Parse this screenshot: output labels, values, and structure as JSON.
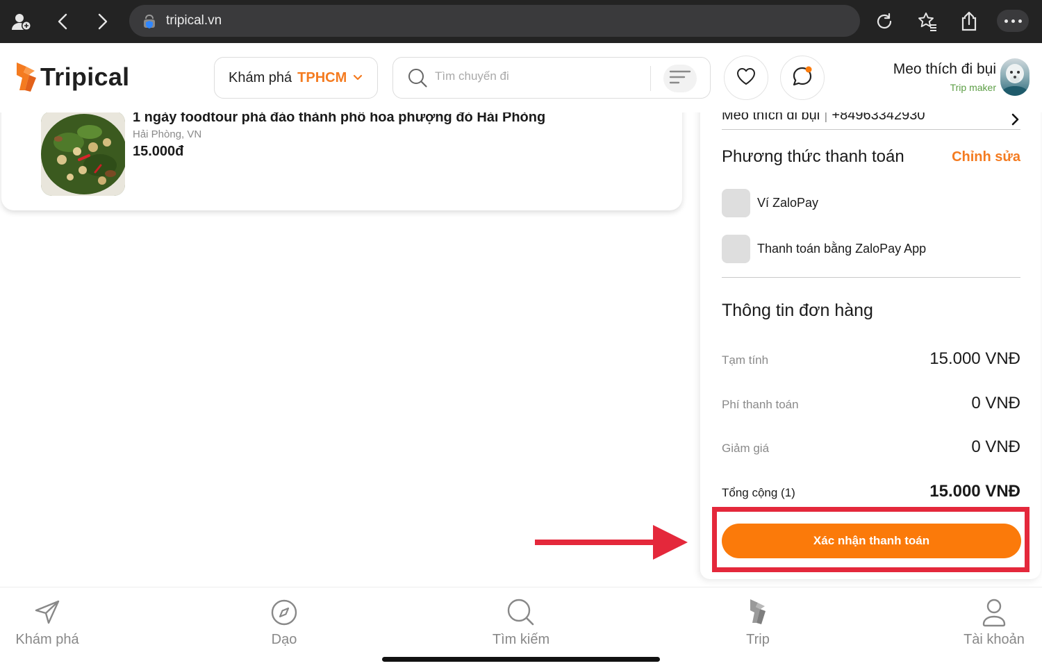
{
  "browser": {
    "url": "tripical.vn"
  },
  "header": {
    "logo_text": "Tripical",
    "explore_label": "Khám phá",
    "explore_city": "TPHCM",
    "search_placeholder": "Tìm chuyến đi",
    "user_name": "Meo thích đi bụi",
    "user_role": "Trip maker"
  },
  "product": {
    "title": "1 ngày foodtour phá đảo thành phố hoa phượng đỏ Hải Phòng",
    "location": "Hải Phòng, VN",
    "price": "15.000đ"
  },
  "checkout": {
    "contact_name": "Meo thích đi bụi",
    "contact_phone": "+84963342930",
    "payment_title": "Phương thức thanh toán",
    "payment_edit": "Chỉnh sửa",
    "payment_options": [
      {
        "label": "Ví ZaloPay"
      },
      {
        "label": "Thanh toán bằng ZaloPay App"
      }
    ],
    "order_title": "Thông tin đơn hàng",
    "order_rows": [
      {
        "label": "Tạm tính",
        "value": "15.000 VNĐ"
      },
      {
        "label": "Phí thanh toán",
        "value": "0 VNĐ"
      },
      {
        "label": "Giảm giá",
        "value": "0 VNĐ"
      },
      {
        "label": "Tổng cộng (1)",
        "value": "15.000 VNĐ"
      }
    ],
    "confirm_label": "Xác nhận thanh toán"
  },
  "bottom_nav": [
    {
      "label": "Khám phá",
      "icon": "send-icon"
    },
    {
      "label": "Dạo",
      "icon": "compass-icon"
    },
    {
      "label": "Tìm kiếm",
      "icon": "search-icon"
    },
    {
      "label": "Trip",
      "icon": "trip-logo-icon"
    },
    {
      "label": "Tài khoản",
      "icon": "user-icon"
    }
  ],
  "colors": {
    "accent": "#fb7a0a",
    "brand_orange": "#f47b20",
    "annotation_red": "#e4283b",
    "trip_maker_green": "#5c9e45"
  }
}
